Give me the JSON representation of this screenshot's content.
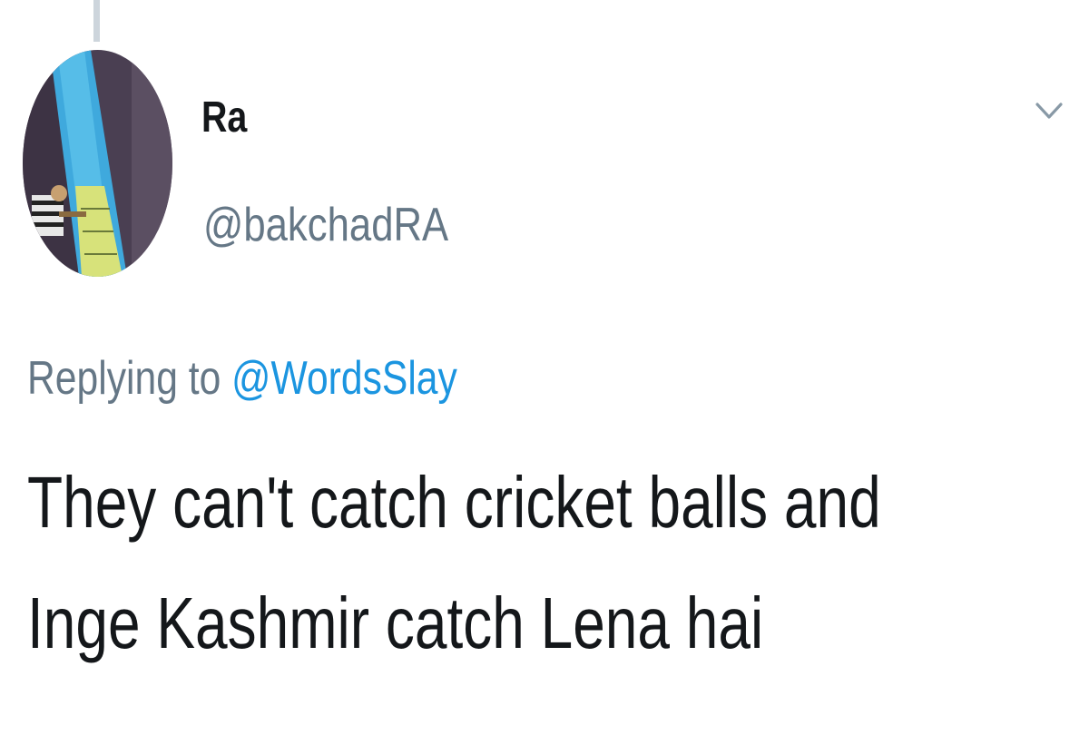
{
  "tweet": {
    "author": {
      "display_name": "Ra",
      "handle": "@bakchadRA",
      "avatar_icon": "avatar-image"
    },
    "menu_icon": "chevron-down-icon",
    "replying_to_prefix": "Replying to",
    "replying_to_mention": "@WordsSlay",
    "text_lines": [
      "They can't catch cricket balls and",
      "Inge Kashmir catch Lena hai"
    ]
  },
  "colors": {
    "primary_text": "#14171a",
    "secondary_text": "#657786",
    "link": "#1b95e0",
    "thread_line": "#cdd5dc"
  }
}
